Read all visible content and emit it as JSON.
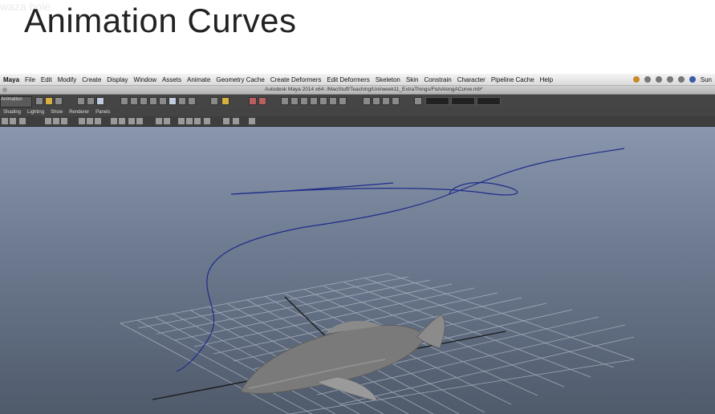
{
  "slide": {
    "title": "Animation Curves",
    "watermark": "waza boie"
  },
  "menubar": {
    "items": [
      "Maya",
      "File",
      "Edit",
      "Modify",
      "Create",
      "Display",
      "Window",
      "Assets",
      "Animate",
      "Geometry Cache",
      "Create Deformers",
      "Edit Deformers",
      "Skeleton",
      "Skin",
      "Constrain",
      "Character",
      "Pipeline Cache",
      "Help"
    ],
    "clock": "Sun"
  },
  "window": {
    "title": "Autodesk Maya 2014 x64: /MacStuff/Teaching/Uni/week11_ExtraThings/FishAlongACurve.mb*"
  },
  "statusline": {
    "mode": "Animation"
  },
  "panel": {
    "menu": [
      "Shading",
      "Lighting",
      "Show",
      "Renderer",
      "Panels"
    ]
  },
  "colors": {
    "curve": "#1f2c8a",
    "grid": "#b9c0cc",
    "grid_axis": "#1a1a1a",
    "fish": "#7a7a7a",
    "viewport_top": "#8996ad",
    "viewport_bottom": "#4f5a6b"
  }
}
